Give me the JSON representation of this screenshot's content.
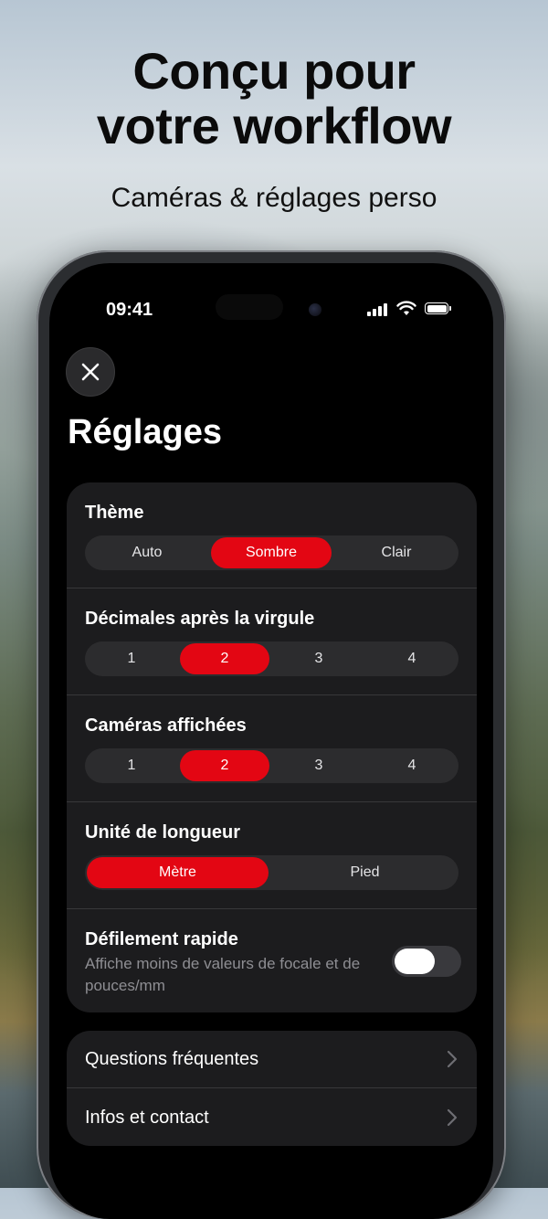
{
  "marketing": {
    "headline_line1": "Conçu pour",
    "headline_line2": "votre workflow",
    "subheadline": "Caméras & réglages perso"
  },
  "status_bar": {
    "time": "09:41"
  },
  "screen": {
    "title": "Réglages"
  },
  "settings": {
    "theme": {
      "label": "Thème",
      "options": [
        "Auto",
        "Sombre",
        "Clair"
      ],
      "selected": "Sombre"
    },
    "decimals": {
      "label": "Décimales après la virgule",
      "options": [
        "1",
        "2",
        "3",
        "4"
      ],
      "selected": "2"
    },
    "cameras": {
      "label": "Caméras affichées",
      "options": [
        "1",
        "2",
        "3",
        "4"
      ],
      "selected": "2"
    },
    "length_unit": {
      "label": "Unité de longueur",
      "options": [
        "Mètre",
        "Pied"
      ],
      "selected": "Mètre"
    },
    "fast_scroll": {
      "label": "Défilement rapide",
      "description": "Affiche moins de valeurs de focale et de pouces/mm",
      "enabled": false
    }
  },
  "links": [
    {
      "label": "Questions fréquentes"
    },
    {
      "label": "Infos et contact"
    }
  ],
  "colors": {
    "accent": "#e30613",
    "card_bg": "#1c1c1e",
    "segment_bg": "#2c2c2e",
    "screen_bg": "#000000"
  },
  "icons": {
    "close": "close-icon",
    "chevron": "chevron-right-icon",
    "signal": "cellular-signal-icon",
    "wifi": "wifi-icon",
    "battery": "battery-icon"
  }
}
